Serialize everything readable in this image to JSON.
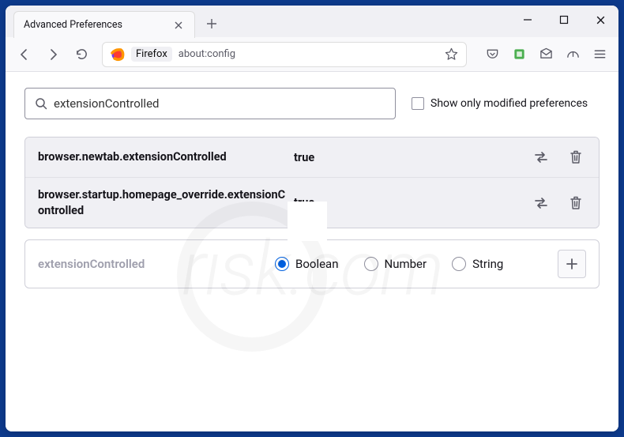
{
  "tab": {
    "title": "Advanced Preferences"
  },
  "urlbar": {
    "product": "Firefox",
    "url": "about:config"
  },
  "search": {
    "value": "extensionControlled"
  },
  "filter": {
    "label": "Show only modified preferences"
  },
  "prefs": [
    {
      "name": "browser.newtab.extensionControlled",
      "value": "true"
    },
    {
      "name": "browser.startup.homepage_override.extensionControlled",
      "value": "true"
    }
  ],
  "add_row": {
    "name": "extensionControlled",
    "options": [
      "Boolean",
      "Number",
      "String"
    ],
    "selected": "Boolean"
  },
  "watermark": "rısk.com"
}
